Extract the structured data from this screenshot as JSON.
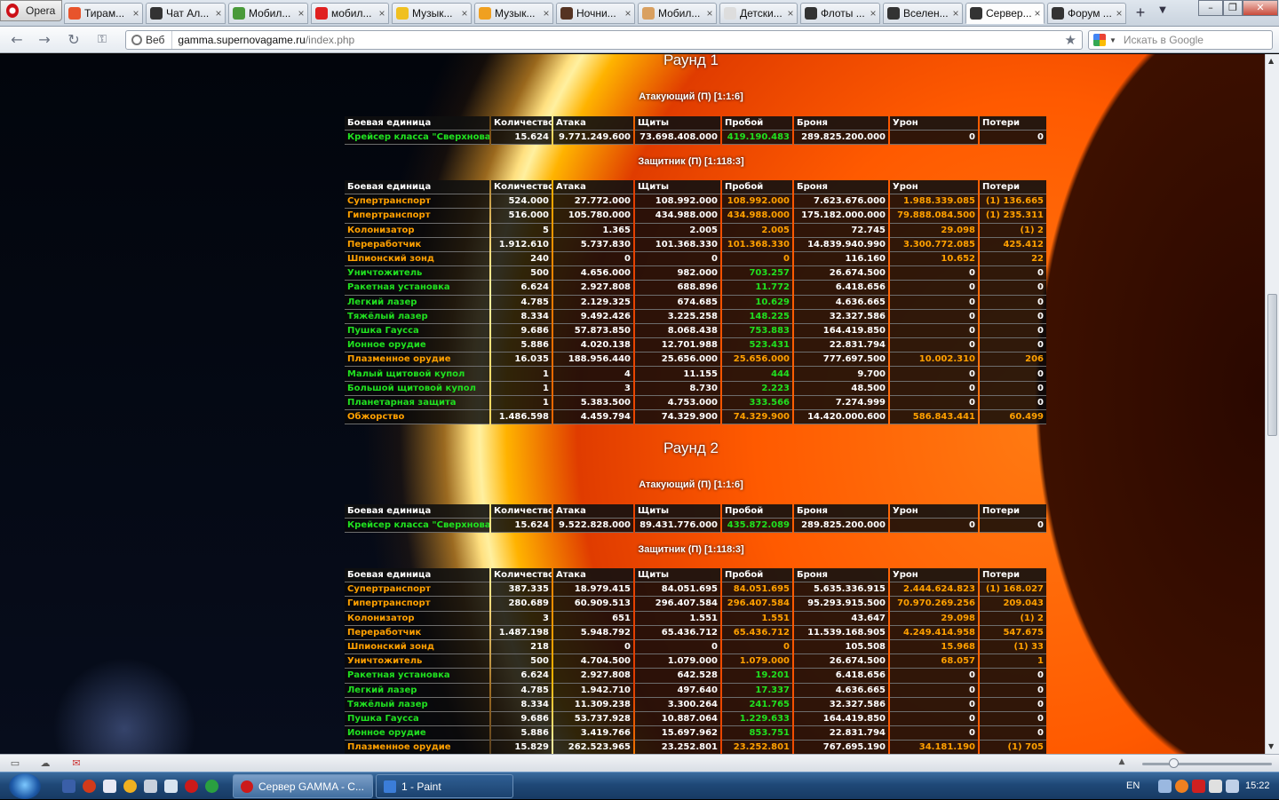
{
  "browser": {
    "menu_label": "Opera",
    "tabs": [
      {
        "title": "Тирам...",
        "color": "#e8542c"
      },
      {
        "title": "Чат Ал...",
        "color": "#333333"
      },
      {
        "title": "Мобил...",
        "color": "#4a9a3a"
      },
      {
        "title": "мобил...",
        "color": "#e02020"
      },
      {
        "title": "Музык...",
        "color": "#f0c020"
      },
      {
        "title": "Музык...",
        "color": "#f0a020"
      },
      {
        "title": "Ночни...",
        "color": "#553322"
      },
      {
        "title": "Мобил...",
        "color": "#d9a060"
      },
      {
        "title": "Детски...",
        "color": "#dddddd"
      },
      {
        "title": "Флоты ...",
        "color": "#333333"
      },
      {
        "title": "Вселен...",
        "color": "#333333"
      },
      {
        "title": "Сервер...",
        "color": "#333333"
      },
      {
        "title": "Форум ...",
        "color": "#333333"
      }
    ],
    "active_tab_index": 11,
    "addr_badge": "Веб",
    "url_host": "gamma.supernovagame.ru",
    "url_path": "/index.php",
    "search_placeholder": "Искать в Google"
  },
  "columns": [
    "Боевая единица",
    "Количество",
    "Атака",
    "Щиты",
    "Пробой",
    "Броня",
    "Урон",
    "Потери"
  ],
  "rounds": [
    {
      "title": "Раунд 1",
      "attacker": {
        "title": "Атакующий (П) [1:1:6]",
        "rows": [
          {
            "unit": "Крейсер класса \"Сверхновая\"",
            "qty": "15.624",
            "atk": "9.771.249.600",
            "shd": "73.698.408.000",
            "pen": "419.190.483",
            "arm": "289.825.200.000",
            "dmg": "0",
            "loss": "0",
            "pc": "g",
            "dc": "n",
            "lc": "n"
          }
        ]
      },
      "defender": {
        "title": "Защитник (П) [1:118:3]",
        "rows": [
          {
            "unit": "Супертранспорт",
            "qty": "524.000",
            "atk": "27.772.000",
            "shd": "108.992.000",
            "pen": "108.992.000",
            "arm": "7.623.676.000",
            "dmg": "1.988.339.085",
            "loss": "(1) 136.665",
            "pc": "o",
            "dc": "o",
            "lc": "o"
          },
          {
            "unit": "Гипертранспорт",
            "qty": "516.000",
            "atk": "105.780.000",
            "shd": "434.988.000",
            "pen": "434.988.000",
            "arm": "175.182.000.000",
            "dmg": "79.888.084.500",
            "loss": "(1) 235.311",
            "pc": "o",
            "dc": "o",
            "lc": "o"
          },
          {
            "unit": "Колонизатор",
            "qty": "5",
            "atk": "1.365",
            "shd": "2.005",
            "pen": "2.005",
            "arm": "72.745",
            "dmg": "29.098",
            "loss": "(1) 2",
            "pc": "o",
            "dc": "o",
            "lc": "o"
          },
          {
            "unit": "Переработчик",
            "qty": "1.912.610",
            "atk": "5.737.830",
            "shd": "101.368.330",
            "pen": "101.368.330",
            "arm": "14.839.940.990",
            "dmg": "3.300.772.085",
            "loss": "425.412",
            "pc": "o",
            "dc": "o",
            "lc": "o"
          },
          {
            "unit": "Шпионский зонд",
            "qty": "240",
            "atk": "0",
            "shd": "0",
            "pen": "0",
            "arm": "116.160",
            "dmg": "10.652",
            "loss": "22",
            "pc": "o",
            "dc": "o",
            "lc": "o"
          },
          {
            "unit": "Уничтожитель",
            "qty": "500",
            "atk": "4.656.000",
            "shd": "982.000",
            "pen": "703.257",
            "arm": "26.674.500",
            "dmg": "0",
            "loss": "0",
            "pc": "g",
            "dc": "n",
            "lc": "n"
          },
          {
            "unit": "Ракетная установка",
            "qty": "6.624",
            "atk": "2.927.808",
            "shd": "688.896",
            "pen": "11.772",
            "arm": "6.418.656",
            "dmg": "0",
            "loss": "0",
            "pc": "g",
            "dc": "n",
            "lc": "n"
          },
          {
            "unit": "Легкий лазер",
            "qty": "4.785",
            "atk": "2.129.325",
            "shd": "674.685",
            "pen": "10.629",
            "arm": "4.636.665",
            "dmg": "0",
            "loss": "0",
            "pc": "g",
            "dc": "n",
            "lc": "n"
          },
          {
            "unit": "Тяжёлый лазер",
            "qty": "8.334",
            "atk": "9.492.426",
            "shd": "3.225.258",
            "pen": "148.225",
            "arm": "32.327.586",
            "dmg": "0",
            "loss": "0",
            "pc": "g",
            "dc": "n",
            "lc": "n"
          },
          {
            "unit": "Пушка Гаусса",
            "qty": "9.686",
            "atk": "57.873.850",
            "shd": "8.068.438",
            "pen": "753.883",
            "arm": "164.419.850",
            "dmg": "0",
            "loss": "0",
            "pc": "g",
            "dc": "n",
            "lc": "n"
          },
          {
            "unit": "Ионное орудие",
            "qty": "5.886",
            "atk": "4.020.138",
            "shd": "12.701.988",
            "pen": "523.431",
            "arm": "22.831.794",
            "dmg": "0",
            "loss": "0",
            "pc": "g",
            "dc": "n",
            "lc": "n"
          },
          {
            "unit": "Плазменное орудие",
            "qty": "16.035",
            "atk": "188.956.440",
            "shd": "25.656.000",
            "pen": "25.656.000",
            "arm": "777.697.500",
            "dmg": "10.002.310",
            "loss": "206",
            "pc": "o",
            "dc": "o",
            "lc": "o"
          },
          {
            "unit": "Малый щитовой купол",
            "qty": "1",
            "atk": "4",
            "shd": "11.155",
            "pen": "444",
            "arm": "9.700",
            "dmg": "0",
            "loss": "0",
            "pc": "g",
            "dc": "n",
            "lc": "n"
          },
          {
            "unit": "Большой щитовой купол",
            "qty": "1",
            "atk": "3",
            "shd": "8.730",
            "pen": "2.223",
            "arm": "48.500",
            "dmg": "0",
            "loss": "0",
            "pc": "g",
            "dc": "n",
            "lc": "n"
          },
          {
            "unit": "Планетарная защита",
            "qty": "1",
            "atk": "5.383.500",
            "shd": "4.753.000",
            "pen": "333.566",
            "arm": "7.274.999",
            "dmg": "0",
            "loss": "0",
            "pc": "g",
            "dc": "n",
            "lc": "n"
          },
          {
            "unit": "Обжорство",
            "qty": "1.486.598",
            "atk": "4.459.794",
            "shd": "74.329.900",
            "pen": "74.329.900",
            "arm": "14.420.000.600",
            "dmg": "586.843.441",
            "loss": "60.499",
            "pc": "o",
            "dc": "o",
            "lc": "o"
          }
        ]
      }
    },
    {
      "title": "Раунд 2",
      "attacker": {
        "title": "Атакующий (П) [1:1:6]",
        "rows": [
          {
            "unit": "Крейсер класса \"Сверхновая\"",
            "qty": "15.624",
            "atk": "9.522.828.000",
            "shd": "89.431.776.000",
            "pen": "435.872.089",
            "arm": "289.825.200.000",
            "dmg": "0",
            "loss": "0",
            "pc": "g",
            "dc": "n",
            "lc": "n"
          }
        ]
      },
      "defender": {
        "title": "Защитник (П) [1:118:3]",
        "rows": [
          {
            "unit": "Супертранспорт",
            "qty": "387.335",
            "atk": "18.979.415",
            "shd": "84.051.695",
            "pen": "84.051.695",
            "arm": "5.635.336.915",
            "dmg": "2.444.624.823",
            "loss": "(1) 168.027",
            "pc": "o",
            "dc": "o",
            "lc": "o"
          },
          {
            "unit": "Гипертранспорт",
            "qty": "280.689",
            "atk": "60.909.513",
            "shd": "296.407.584",
            "pen": "296.407.584",
            "arm": "95.293.915.500",
            "dmg": "70.970.269.256",
            "loss": "209.043",
            "pc": "o",
            "dc": "o",
            "lc": "o"
          },
          {
            "unit": "Колонизатор",
            "qty": "3",
            "atk": "651",
            "shd": "1.551",
            "pen": "1.551",
            "arm": "43.647",
            "dmg": "29.098",
            "loss": "(1) 2",
            "pc": "o",
            "dc": "o",
            "lc": "o"
          },
          {
            "unit": "Переработчик",
            "qty": "1.487.198",
            "atk": "5.948.792",
            "shd": "65.436.712",
            "pen": "65.436.712",
            "arm": "11.539.168.905",
            "dmg": "4.249.414.958",
            "loss": "547.675",
            "pc": "o",
            "dc": "o",
            "lc": "o"
          },
          {
            "unit": "Шпионский зонд",
            "qty": "218",
            "atk": "0",
            "shd": "0",
            "pen": "0",
            "arm": "105.508",
            "dmg": "15.968",
            "loss": "(1) 33",
            "pc": "o",
            "dc": "o",
            "lc": "o"
          },
          {
            "unit": "Уничтожитель",
            "qty": "500",
            "atk": "4.704.500",
            "shd": "1.079.000",
            "pen": "1.079.000",
            "arm": "26.674.500",
            "dmg": "68.057",
            "loss": "1",
            "pc": "o",
            "dc": "o",
            "lc": "o"
          },
          {
            "unit": "Ракетная установка",
            "qty": "6.624",
            "atk": "2.927.808",
            "shd": "642.528",
            "pen": "19.201",
            "arm": "6.418.656",
            "dmg": "0",
            "loss": "0",
            "pc": "g",
            "dc": "n",
            "lc": "n"
          },
          {
            "unit": "Легкий лазер",
            "qty": "4.785",
            "atk": "1.942.710",
            "shd": "497.640",
            "pen": "17.337",
            "arm": "4.636.665",
            "dmg": "0",
            "loss": "0",
            "pc": "g",
            "dc": "n",
            "lc": "n"
          },
          {
            "unit": "Тяжёлый лазер",
            "qty": "8.334",
            "atk": "11.309.238",
            "shd": "3.300.264",
            "pen": "241.765",
            "arm": "32.327.586",
            "dmg": "0",
            "loss": "0",
            "pc": "g",
            "dc": "n",
            "lc": "n"
          },
          {
            "unit": "Пушка Гаусса",
            "qty": "9.686",
            "atk": "53.737.928",
            "shd": "10.887.064",
            "pen": "1.229.633",
            "arm": "164.419.850",
            "dmg": "0",
            "loss": "0",
            "pc": "g",
            "dc": "n",
            "lc": "n"
          },
          {
            "unit": "Ионное орудие",
            "qty": "5.886",
            "atk": "3.419.766",
            "shd": "15.697.962",
            "pen": "853.751",
            "arm": "22.831.794",
            "dmg": "0",
            "loss": "0",
            "pc": "g",
            "dc": "n",
            "lc": "n"
          },
          {
            "unit": "Плазменное орудие",
            "qty": "15.829",
            "atk": "262.523.965",
            "shd": "23.252.801",
            "pen": "23.252.801",
            "arm": "767.695.190",
            "dmg": "34.181.190",
            "loss": "(1) 705",
            "pc": "o",
            "dc": "o",
            "lc": "o"
          }
        ]
      }
    }
  ],
  "taskbar": {
    "tasks": [
      {
        "title": "Сервер GAMMA - С...",
        "color": "#cc1a1a"
      },
      {
        "title": "1 - Paint",
        "color": "#3b7dd8"
      }
    ],
    "lang": "EN",
    "clock": "15:22"
  }
}
